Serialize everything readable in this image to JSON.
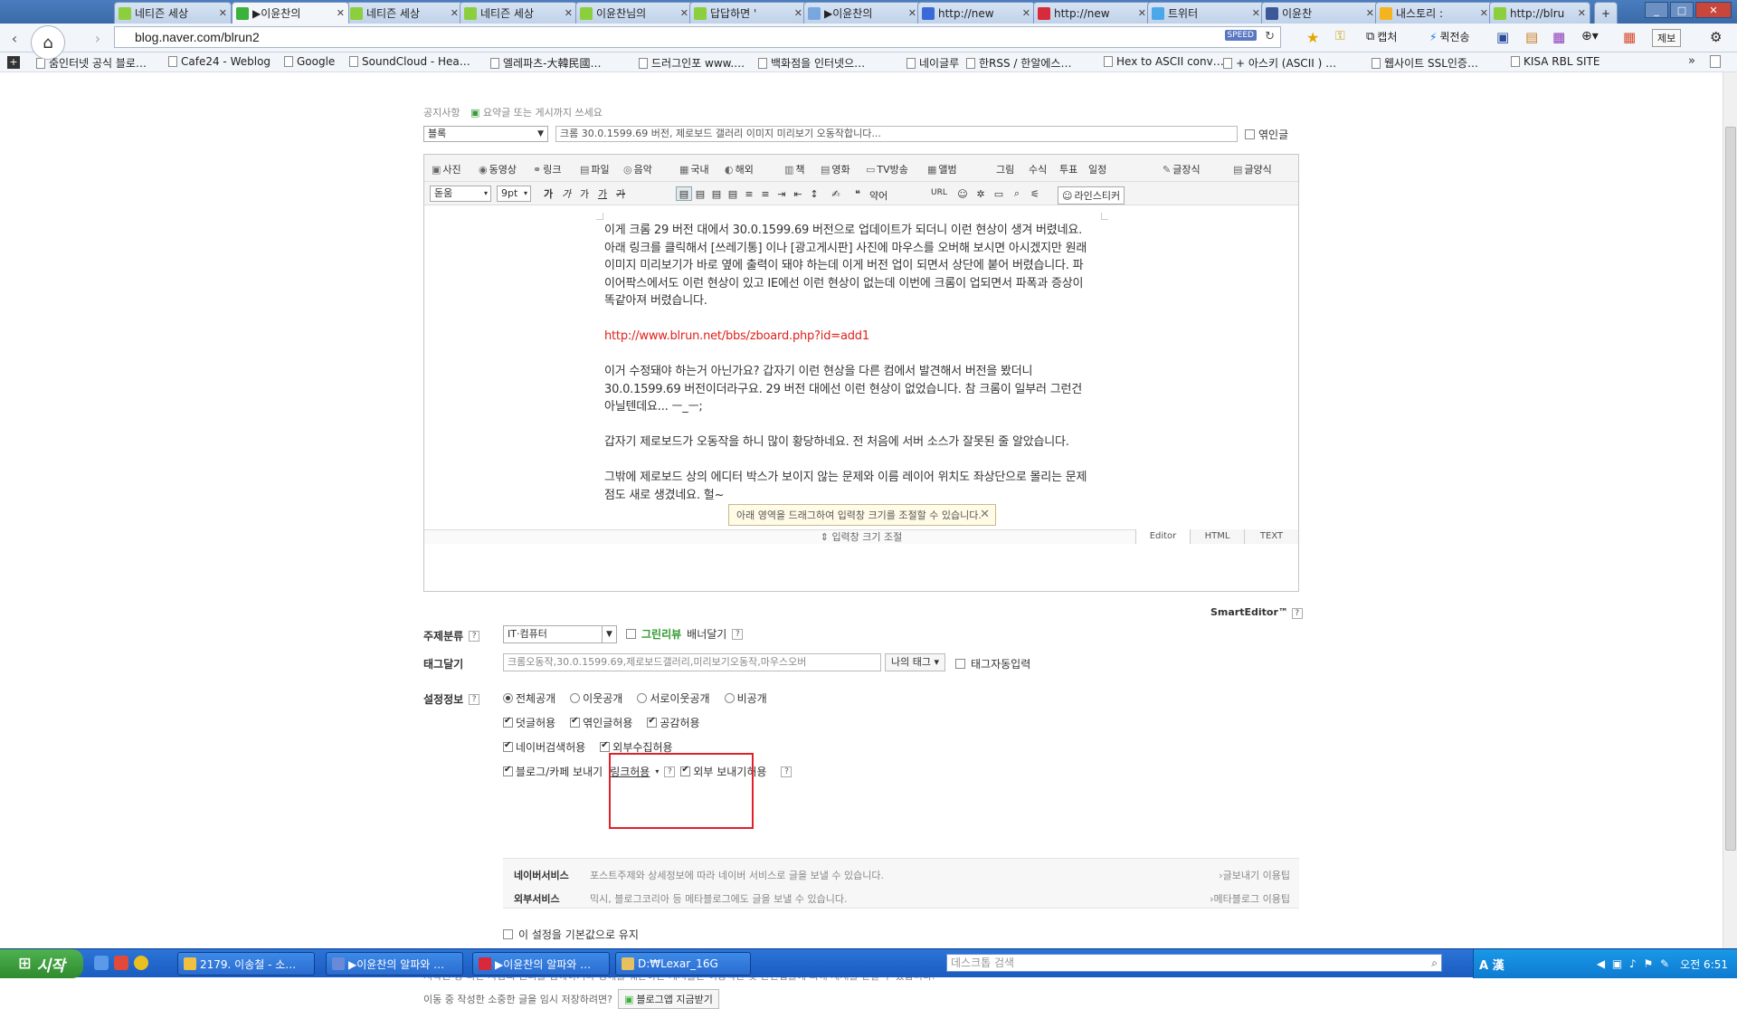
{
  "browser": {
    "tabs": [
      {
        "title": "네티즌 세상",
        "color": "#8ccf3c"
      },
      {
        "title": "▶이윤찬의",
        "color": "#3cb13c"
      },
      {
        "title": "네티즌 세상",
        "color": "#8ccf3c"
      },
      {
        "title": "네티즌 세상",
        "color": "#8ccf3c"
      },
      {
        "title": "이윤찬님의",
        "color": "#8ccf3c"
      },
      {
        "title": "답답하면 '",
        "color": "#8ccf3c"
      },
      {
        "title": "▶이윤찬의",
        "color": "#7aa6de"
      },
      {
        "title": "http://new",
        "color": "#3a6ad8"
      },
      {
        "title": "http://new",
        "color": "#d82a3a"
      },
      {
        "title": "트위터",
        "color": "#4aa8e8"
      },
      {
        "title": "이윤찬",
        "color": "#3b5998"
      },
      {
        "title": "내스토리 :",
        "color": "#f5b41e"
      },
      {
        "title": "http://blru",
        "color": "#8ccf3c"
      }
    ],
    "url": "blog.naver.com/blrun2",
    "speed_badge": "SPEED",
    "toolbar": {
      "capture": "캡처",
      "quicksend": "퀵전송",
      "report": "제보"
    },
    "bookmarks": [
      "줌인터넷 공식 블로…",
      "Cafe24 - Weblog",
      "Google",
      "SoundCloud - Hea…",
      "엘레파츠-大韓民國…",
      "드러그인포 www.…",
      "백화점을 인터넷으…",
      "네이글루",
      "한RSS / 한알에스…",
      "Hex to ASCII conv…",
      "+ 아스키 (ASCII ) …",
      "웹사이트 SSL인증…",
      "KISA RBL SITE"
    ]
  },
  "post": {
    "notice_label": "공지사항",
    "notice_hint": "요약글 또는 게시까지 쓰세요",
    "category": "블록",
    "title": "크롬 30.0.1599.69 버전, 제로보드 갤러리 이미지 미리보기 오동작합니다...",
    "public_label": "엮인글"
  },
  "editor": {
    "toolbar1": [
      "사진",
      "동영상",
      "링크",
      "파일",
      "음악",
      "국내",
      "해외",
      "책",
      "영화",
      "TV방송",
      "앨범",
      "그림",
      "수식",
      "투표",
      "일정",
      "글장식",
      "글양식"
    ],
    "font": "돋움",
    "size": "9pt",
    "format_labels": [
      "가",
      "가",
      "가",
      "가",
      "가"
    ],
    "extras": [
      "약어",
      "URL",
      "라인스티커"
    ],
    "body": [
      "이게 크롬 29 버전 대에서 30.0.1599.69 버전으로 업데이트가 되더니 이런 현상이 생겨 버렸네요. 아래 링크를 클릭해서 [쓰레기통] 이나 [광고게시판] 사진에 마우스를 오버해 보시면 아시겠지만 원래 이미지 미리보기가 바로 옆에 출력이 돼야 하는데 이게 버전 업이 되면서 상단에 붙어 버렸습니다. 파이어팍스에서도 이런 현상이 있고 IE에선 이런 현상이 없는데 이번에 크롬이 업되면서 파폭과 증상이 똑같아져 버렸습니다.",
      "http://www.blrun.net/bbs/zboard.php?id=add1",
      "이거 수정돼야 하는거 아닌가요? 갑자기 이런 현상을 다른 컴에서 발견해서 버전을 봤더니 30.0.1599.69 버전이더라구요. 29 버전 대에선 이런 현상이 없었습니다. 참 크롬이 일부러 그런건 아닐텐데요... ㅡ_ㅡ;",
      "갑자기 제로보드가 오동작을 하니 많이 황당하네요. 전 처음에 서버 소스가 잘못된 줄 알았습니다.",
      "그밖에 제로보드 상의 에디터 박스가 보이지 않는 문제와 이름 레이어 위치도 좌상단으로 몰리는 문제점도 새로 생겼네요. 헐~"
    ],
    "resize_tip": "아래 영역을 드래그하여 입력창 크기를 조절할 수 있습니다.",
    "resize_bar": "입력창 크기 조절",
    "modes": [
      "Editor",
      "HTML",
      "TEXT"
    ],
    "brand": "SmartEditor™"
  },
  "settings": {
    "subject_label": "주제분류",
    "subject_value": "IT·컴퓨터",
    "greenreview": "그린리뷰",
    "banner": "배너달기",
    "tag_label": "태그달기",
    "tag_value": "크롬오동작,30.0.1599.69,제로보드갤러리,미리보기오동작,마우스오버",
    "my_tag": "나의 태그",
    "auto_tag": "태그자동입력",
    "info_label": "설정정보",
    "visibility": [
      "전체공개",
      "이웃공개",
      "서로이웃공개",
      "비공개"
    ],
    "perm_row1": [
      "덧글허용",
      "엮인글허용",
      "공감허용"
    ],
    "perm_row2": [
      "네이버검색허용",
      "외부수집허용"
    ],
    "send_blog": "블로그/카페 보내기",
    "link_allow": "링크허용",
    "external_send": "외부 보내기허용",
    "naver_service": "네이버서비스",
    "naver_desc": "포스트주제와 상세정보에 따라 네이버 서비스로 글을 보낼 수 있습니다.",
    "naver_link": "글보내기 이용팁",
    "external_service": "외부서비스",
    "external_desc": "믹시, 블로그코리아 등 메타블로그에도 글을 보낼 수 있습니다.",
    "external_link": "메타블로그 이용팁",
    "keep_default": "이 설정을 기본값으로 유지",
    "copyright": "저작권 등 다른 사람의 권리를 침해하거나 명예를 훼손하는 게시물은 이용약관 및 관련법률에 의해 제재를 받을 수 있습니다.",
    "save_question": "이동 중 작성한 소중한 글을 임시 저장하려면?",
    "save_button": "블로그앱 지금받기"
  },
  "taskbar": {
    "start": "시작",
    "windows": [
      "2179. 이송철 - 소…",
      "▶이윤찬의 알파와 …",
      "▶이윤찬의 알파와 …",
      "D:₩Lexar_16G"
    ],
    "desktop_search": "데스크톱 검색",
    "clock": "오전 6:51"
  }
}
